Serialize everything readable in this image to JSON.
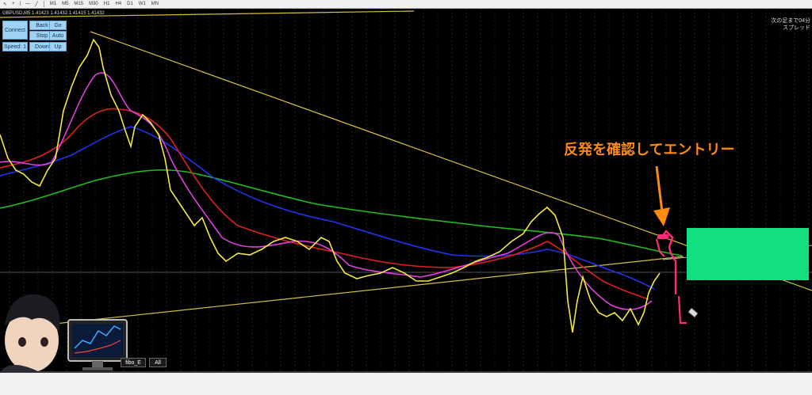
{
  "toolbar": {
    "timeframes": [
      "M1",
      "M5",
      "M15",
      "M30",
      "H1",
      "H4",
      "D1",
      "W1",
      "MN"
    ]
  },
  "chart": {
    "symbol_info": "GBPUSD,M5  1.41423 1.41432 1.41415 1.41432",
    "corner_line1": "次の足まで04分",
    "corner_line2": "スプレッド",
    "annotation": "反発を確認してエントリー",
    "colors": {
      "background": "#000000",
      "price": "#f4e842",
      "ema_fast": "#e23de0",
      "ema_mid": "#e02020",
      "ema_slow": "#2233ee",
      "ema_long": "#22bb22",
      "trendline": "#d6c040",
      "zone": "#12e080",
      "marker": "#ff2a7a",
      "annotation": "#ff8a10"
    }
  },
  "controls": {
    "connect": "Connect",
    "back": "Back",
    "go": "Go",
    "stop": "Stop",
    "auto": "Auto",
    "speed": "Speed: 1",
    "down": "Down",
    "up": "Up"
  },
  "bottom_buttons": {
    "fibo": "fibo_E",
    "all": "All"
  }
}
